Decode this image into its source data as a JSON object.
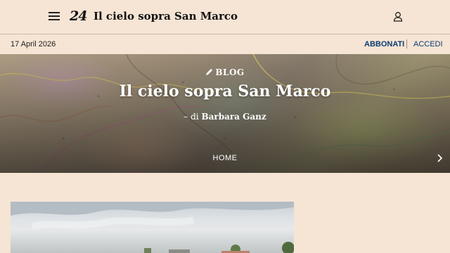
{
  "header": {
    "logo_text": "24",
    "site_title": "Il cielo sopra San Marco"
  },
  "datebar": {
    "date": "17 April 2026",
    "subscribe_label": "ABBONATI",
    "login_label": "ACCEDI"
  },
  "hero": {
    "tag": "BLOG",
    "title": "Il cielo sopra San Marco",
    "author_prefix": "– di",
    "author_name": "Barbara Ganz",
    "nav_label": "HOME"
  },
  "icons": {
    "menu": "hamburger-menu-icon",
    "user": "user-icon",
    "pencil": "pencil-icon",
    "next": "chevron-right-icon"
  },
  "colors": {
    "background": "#f6e4d4",
    "link": "#0b3d73"
  }
}
